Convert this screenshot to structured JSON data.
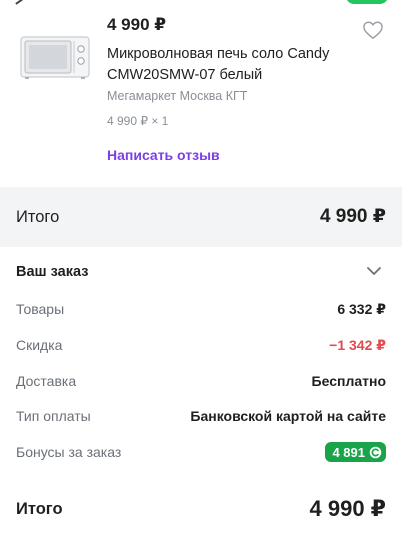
{
  "colors": {
    "accent_purple": "#7b3fe4",
    "discount_red": "#e5484d",
    "bonus_green": "#1aa44a",
    "band_gray": "#f2f4f5"
  },
  "product": {
    "price": "4 990 ₽",
    "title": "Микроволновая печь соло Candy CMW20SMW-07 белый",
    "seller": "Мегамаркет Москва КГТ",
    "quantity": "4 990 ₽ × 1",
    "review_link": "Написать отзыв",
    "image_icon": "microwave-image",
    "favorite_icon": "heart-icon"
  },
  "total_band": {
    "label": "Итого",
    "value": "4 990 ₽"
  },
  "order": {
    "title": "Ваш заказ",
    "toggle_icon": "chevron-down-icon",
    "rows": [
      {
        "label": "Товары",
        "value": "6 332 ₽"
      },
      {
        "label": "Скидка",
        "value": "−1 342 ₽"
      },
      {
        "label": "Доставка",
        "value": "Бесплатно"
      },
      {
        "label": "Тип оплаты",
        "value": "Банковской картой на сайте"
      }
    ],
    "bonus": {
      "label": "Бонусы за заказ",
      "value": "4 891",
      "icon": "bonus-coin-icon"
    }
  },
  "grand_total": {
    "label": "Итого",
    "value": "4 990 ₽"
  }
}
